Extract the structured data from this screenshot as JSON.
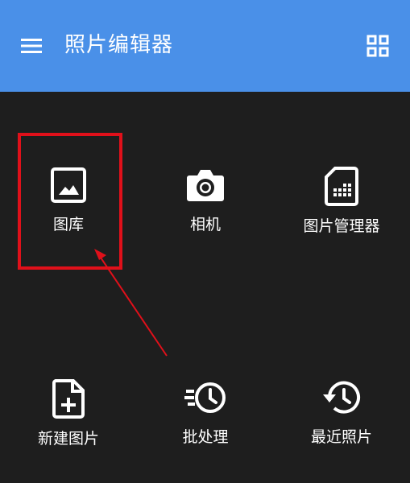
{
  "app_bar": {
    "title": "照片编辑器",
    "menu_icon": "hamburger-menu-icon",
    "view_icon": "grid-view-icon",
    "color": "#4a90e8"
  },
  "tiles": [
    {
      "label": "图库",
      "icon": "gallery-image-icon"
    },
    {
      "label": "相机",
      "icon": "camera-icon"
    },
    {
      "label": "图片管理器",
      "icon": "sd-card-icon"
    },
    {
      "label": "新建图片",
      "icon": "new-file-icon"
    },
    {
      "label": "批处理",
      "icon": "batch-history-icon"
    },
    {
      "label": "最近照片",
      "icon": "recent-history-icon"
    }
  ],
  "annotation": {
    "highlight_color": "#e0101a",
    "target": "图库"
  }
}
